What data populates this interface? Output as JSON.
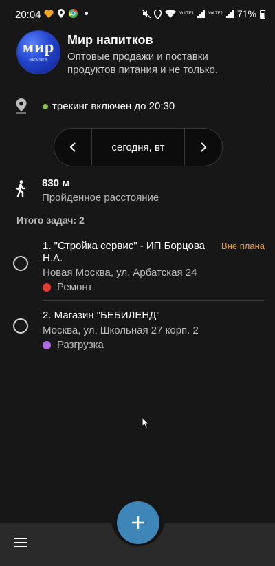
{
  "status_bar": {
    "time": "20:04",
    "battery": "71%",
    "sim1": "VoLTE1",
    "sim2": "VoLTE2"
  },
  "header": {
    "logo_text": "мир",
    "logo_subtext": "НАПИТКОВ",
    "title": "Мир напитков",
    "subtitle": "Оптовые продажи и поставки продуктов питания и не только."
  },
  "tracking": {
    "icon": "location-pin-icon",
    "text": "трекинг включен до 20:30",
    "status_color": "#8bc34a"
  },
  "date_nav": {
    "prev_icon": "chevron-left-icon",
    "label": "сегодня, вт",
    "next_icon": "chevron-right-icon"
  },
  "distance": {
    "icon": "walking-person-icon",
    "value": "830 м",
    "label": "Пройденное расстояние"
  },
  "tasks_total": "Итого задач: 2",
  "tasks": [
    {
      "title": "1.  \"Стройка сервис\" - ИП Борцова Н.А.",
      "tag": "Вне плана",
      "address": "Новая Москва, ул. Арбатская 24",
      "category": "Ремонт",
      "category_color": "#e53935"
    },
    {
      "title": "2.  Магазин \"БЕБИЛЕНД\"",
      "tag": "",
      "address": "Москва, ул. Школьная 27 корп. 2",
      "category": "Разгрузка",
      "category_color": "#b06ae0"
    }
  ],
  "bottom_bar": {
    "menu_icon": "hamburger-menu-icon",
    "fab_icon": "plus-icon",
    "fab_color": "#3e86b8"
  }
}
